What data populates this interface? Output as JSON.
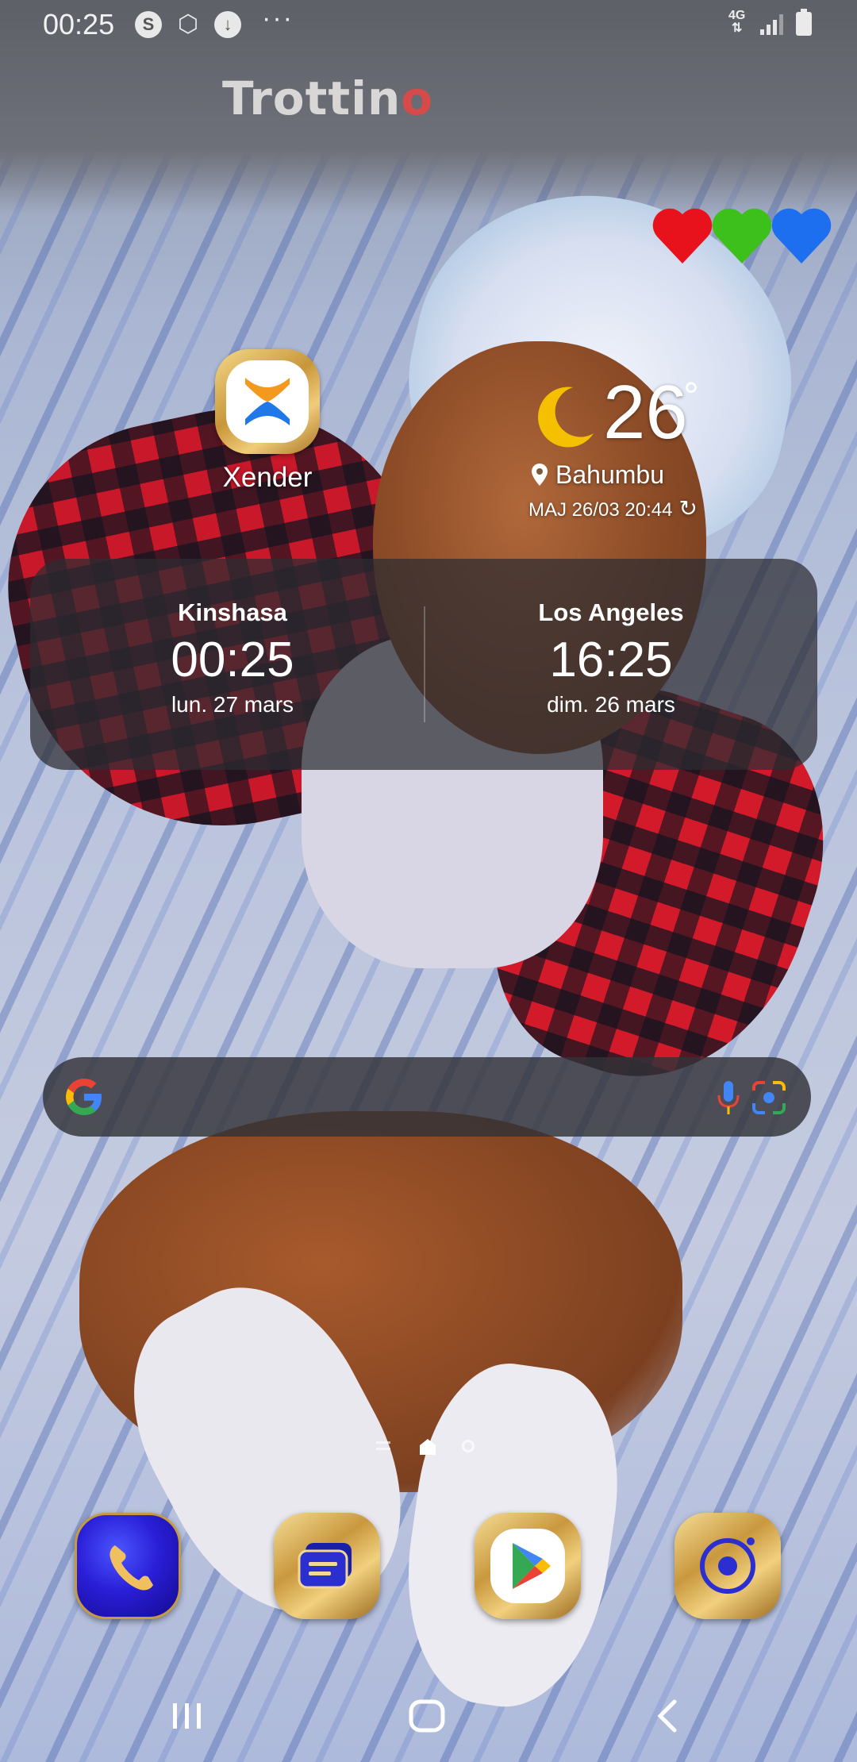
{
  "status_bar": {
    "time": "00:25",
    "icons": [
      "samsung-s-icon",
      "hexagon-app-icon",
      "download-icon"
    ],
    "more": "···",
    "network_type": "4G",
    "signal": "signal-strength-icon",
    "battery": "battery-icon"
  },
  "wallpaper": {
    "brand_text": "Trottin",
    "brand_suffix": "o"
  },
  "apps": {
    "xender": {
      "label": "Xender",
      "icon": "xender-icon"
    }
  },
  "weather": {
    "temperature": "26",
    "degree": "°",
    "location": "Bahumbu",
    "updated": "MAJ 26/03 20:44",
    "condition_icon": "moon-icon",
    "moon_color": "#f5c000"
  },
  "dual_clock": {
    "left": {
      "city": "Kinshasa",
      "time": "00:25",
      "date": "lun. 27 mars"
    },
    "right": {
      "city": "Los Angeles",
      "time": "16:25",
      "date": "dim. 26 mars"
    }
  },
  "search": {
    "logo": "google-g-icon",
    "mic": "mic-icon",
    "lens": "lens-icon"
  },
  "page_indicator": {
    "pages": [
      "feed",
      "home",
      "page-2"
    ],
    "current": "home"
  },
  "dock": {
    "apps": [
      "phone-icon",
      "messages-icon",
      "play-store-icon",
      "camera-icon"
    ]
  },
  "nav": {
    "buttons": [
      "recents",
      "home",
      "back"
    ]
  },
  "colors": {
    "gold": "#c9983e",
    "phone_blue": "#2a1fd8",
    "google_blue": "#4285F4",
    "google_red": "#EA4335",
    "google_yellow": "#FBBC05",
    "google_green": "#34A853"
  }
}
